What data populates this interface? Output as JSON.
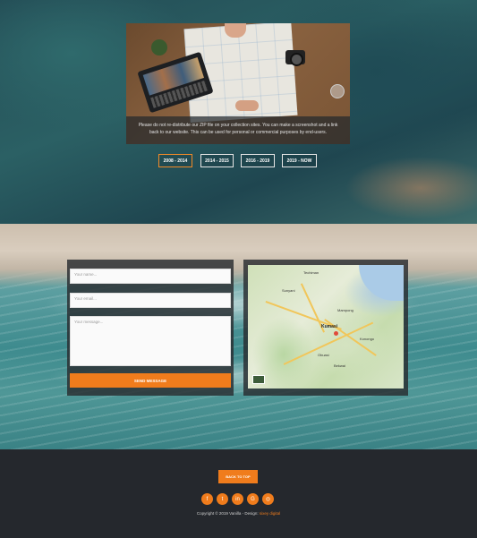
{
  "hero": {
    "caption_line1": "Please do not re-distribute our ZIP file on your collection sites. You can make a screenshot and a link",
    "caption_line2": "back to our website. This can be used for personal or commercial purposes by end-users."
  },
  "timeline_tabs": [
    {
      "label": "2008 - 2014",
      "active": true
    },
    {
      "label": "2014 - 2015",
      "active": false
    },
    {
      "label": "2016 - 2019",
      "active": false
    },
    {
      "label": "2019 - NOW",
      "active": false
    }
  ],
  "contact_form": {
    "name_placeholder": "Your name...",
    "email_placeholder": "Your email...",
    "message_placeholder": "Your message...",
    "send_label": "SEND MESSAGE"
  },
  "map": {
    "center_city": "Kumasi",
    "cities": [
      "Techiman",
      "Sunyani",
      "Mampong",
      "Kumasi",
      "Obuasi",
      "Bekwai",
      "Konongo"
    ]
  },
  "footer": {
    "back_to_top_label": "BACK TO TOP",
    "social_icons": [
      "facebook-icon",
      "twitter-icon",
      "linkedin-icon",
      "google-icon",
      "instagram-icon"
    ],
    "copyright_prefix": "Copyright © 2019 Vanilla - Design:",
    "copyright_brand": "sixey digital"
  },
  "colors": {
    "accent": "#f07c1c",
    "dark": "#25282d",
    "tab_border": "#e7e7e7"
  }
}
